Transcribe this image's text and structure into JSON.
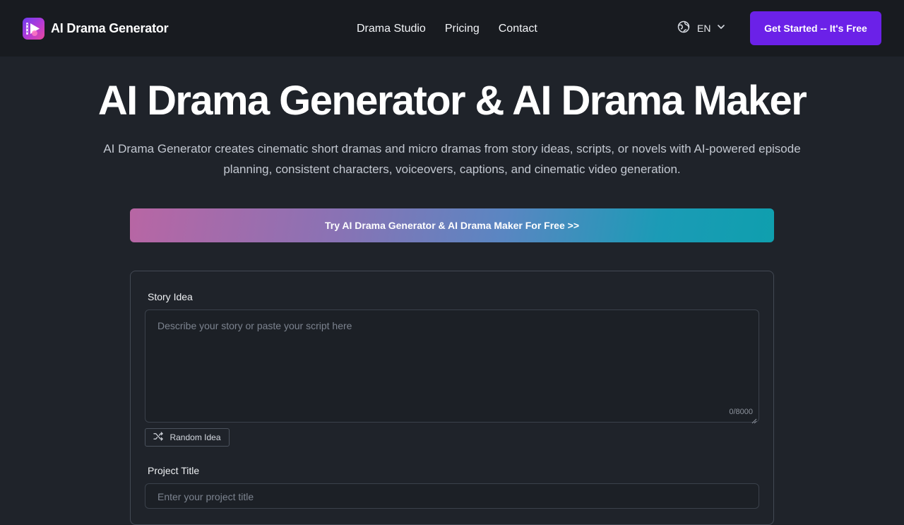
{
  "header": {
    "brand_name": "AI Drama Generator",
    "logo_icon": "film-play-icon",
    "nav": [
      {
        "label": "Drama Studio"
      },
      {
        "label": "Pricing"
      },
      {
        "label": "Contact"
      }
    ],
    "language": {
      "icon": "globe-icon",
      "label": "EN",
      "chevron": "chevron-down-icon"
    },
    "cta_label": "Get Started -- It's Free"
  },
  "hero": {
    "title": "AI Drama Generator & AI Drama Maker",
    "subtitle": "AI Drama Generator creates cinematic short dramas and micro dramas from story ideas, scripts, or novels with AI-powered episode planning, consistent characters, voiceovers, captions, and cinematic video generation.",
    "try_banner_label": "Try AI Drama Generator & AI Drama Maker For Free >>"
  },
  "form": {
    "story_label": "Story Idea",
    "story_placeholder": "Describe your story or paste your script here",
    "story_value": "",
    "char_count": "0/8000",
    "random_idea_label": "Random Idea",
    "random_icon": "shuffle-icon",
    "title_label": "Project Title",
    "title_placeholder": "Enter your project title",
    "title_value": ""
  },
  "colors": {
    "background": "#1f232a",
    "header_bg": "#181b20",
    "accent": "#6b21e8",
    "banner_gradient_start": "#b866a4",
    "banner_gradient_end": "#0f9fae"
  }
}
